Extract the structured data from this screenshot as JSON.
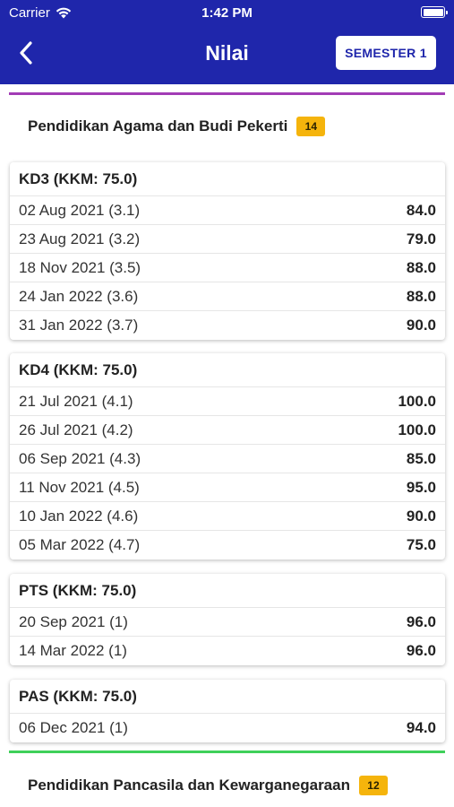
{
  "status_bar": {
    "carrier": "Carrier",
    "time": "1:42 PM"
  },
  "header": {
    "title": "Nilai",
    "semester_button": "SEMESTER 1"
  },
  "colors": {
    "header_bg": "#1f26ab",
    "badge_bg": "#f5b40c",
    "divider_purple": "#a23cb5",
    "divider_green": "#3fd05a"
  },
  "subjects": [
    {
      "name": "Pendidikan Agama dan Budi Pekerti",
      "badge": "14",
      "groups": [
        {
          "title": "KD3 (KKM: 75.0)",
          "rows": [
            {
              "date": "02 Aug 2021 (3.1)",
              "score": "84.0"
            },
            {
              "date": "23 Aug 2021 (3.2)",
              "score": "79.0"
            },
            {
              "date": "18 Nov 2021 (3.5)",
              "score": "88.0"
            },
            {
              "date": "24 Jan 2022 (3.6)",
              "score": "88.0"
            },
            {
              "date": "31 Jan 2022 (3.7)",
              "score": "90.0"
            }
          ]
        },
        {
          "title": "KD4 (KKM: 75.0)",
          "rows": [
            {
              "date": "21 Jul 2021 (4.1)",
              "score": "100.0"
            },
            {
              "date": "26 Jul 2021 (4.2)",
              "score": "100.0"
            },
            {
              "date": "06 Sep 2021 (4.3)",
              "score": "85.0"
            },
            {
              "date": "11 Nov 2021 (4.5)",
              "score": "95.0"
            },
            {
              "date": "10 Jan 2022 (4.6)",
              "score": "90.0"
            },
            {
              "date": "05 Mar 2022 (4.7)",
              "score": "75.0"
            }
          ]
        },
        {
          "title": "PTS (KKM: 75.0)",
          "rows": [
            {
              "date": "20 Sep 2021 (1)",
              "score": "96.0"
            },
            {
              "date": "14 Mar 2022 (1)",
              "score": "96.0"
            }
          ]
        },
        {
          "title": "PAS (KKM: 75.0)",
          "rows": [
            {
              "date": "06 Dec 2021 (1)",
              "score": "94.0"
            }
          ]
        }
      ]
    },
    {
      "name": "Pendidikan Pancasila dan Kewarganegaraan",
      "badge": "12",
      "groups": []
    }
  ]
}
